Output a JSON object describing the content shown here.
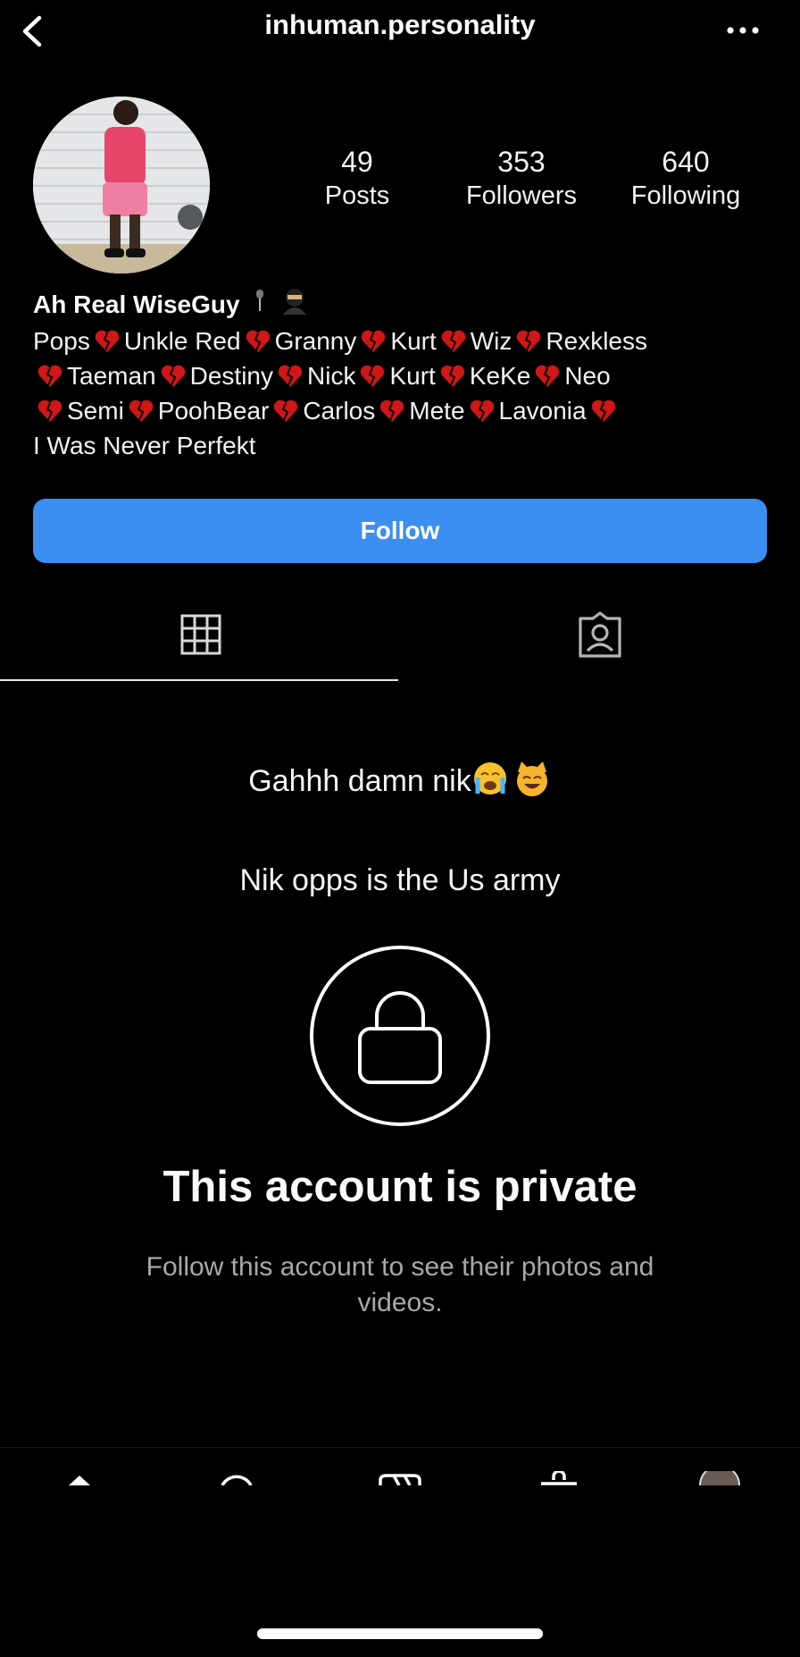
{
  "header": {
    "username": "inhuman.personality"
  },
  "stats": [
    {
      "value": "49",
      "label": "Posts"
    },
    {
      "value": "353",
      "label": "Followers"
    },
    {
      "value": "640",
      "label": "Following"
    }
  ],
  "profile": {
    "display_name": "Ah Real WiseGuy",
    "bio_line1": [
      "Pops",
      "Unkle Red",
      "Granny",
      "Kurt",
      "Wiz",
      "Rexkless"
    ],
    "bio_line2": [
      "Taeman",
      "Destiny",
      "Nick",
      "Kurt",
      "KeKe",
      "Neo"
    ],
    "bio_line3": [
      "Semi",
      "PoohBear",
      "Carlos",
      "Mete",
      "Lavonia"
    ],
    "bio_line4": "I Was Never Perfekt"
  },
  "actions": {
    "follow_label": "Follow"
  },
  "tabs": [
    {
      "icon": "grid-icon"
    },
    {
      "icon": "tagged-icon"
    }
  ],
  "messages": {
    "line1": "Gahhh damn nik",
    "line2": "Nik opps is the Us army"
  },
  "private_notice": {
    "title": "This account is private",
    "subtitle": "Follow this account to see their photos and videos."
  },
  "colors": {
    "accent": "#3b8ff0",
    "heart": "#d01616"
  }
}
